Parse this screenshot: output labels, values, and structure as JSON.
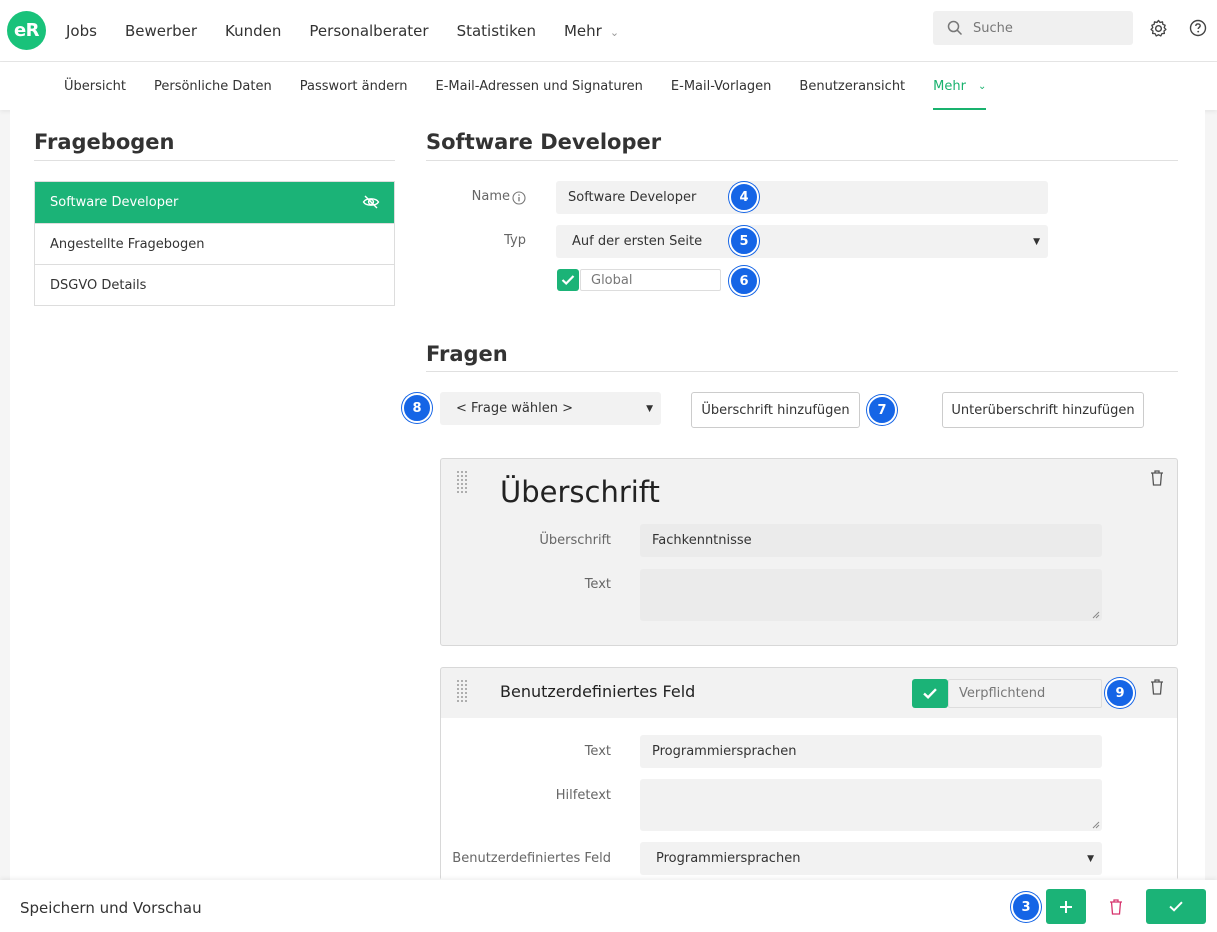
{
  "app": {
    "logo_text": "eR"
  },
  "main_nav": [
    {
      "label": "Jobs"
    },
    {
      "label": "Bewerber"
    },
    {
      "label": "Kunden"
    },
    {
      "label": "Personalberater"
    },
    {
      "label": "Statistiken"
    },
    {
      "label": "Mehr"
    }
  ],
  "search": {
    "placeholder": "Suche"
  },
  "sub_nav": [
    {
      "label": "Übersicht"
    },
    {
      "label": "Persönliche Daten"
    },
    {
      "label": "Passwort ändern"
    },
    {
      "label": "E-Mail-Adressen und Signaturen"
    },
    {
      "label": "E-Mail-Vorlagen"
    },
    {
      "label": "Benutzeransicht"
    },
    {
      "label": "Mehr"
    }
  ],
  "left": {
    "title": "Fragebogen",
    "items": [
      {
        "label": "Software Developer"
      },
      {
        "label": "Angestellte Fragebogen"
      },
      {
        "label": "DSGVO Details"
      }
    ]
  },
  "form": {
    "title": "Software Developer",
    "name_label": "Name",
    "name_value": "Software Developer",
    "typ_label": "Typ",
    "typ_value": "Auf der ersten Seite",
    "global_label": "Global",
    "global_checked": true
  },
  "fragen": {
    "title": "Fragen",
    "select_placeholder": "< Frage wählen >",
    "add_heading_button": "Überschrift hinzufügen",
    "add_subheading_button": "Unterüberschrift hinzufügen"
  },
  "card_heading": {
    "title": "Überschrift",
    "heading_label": "Überschrift",
    "heading_value": "Fachkenntnisse",
    "text_label": "Text",
    "text_value": ""
  },
  "card_custom": {
    "title": "Benutzerdefiniertes Feld",
    "required_label": "Verpflichtend",
    "required_checked": true,
    "text_label": "Text",
    "text_value": "Programmiersprachen",
    "helptext_label": "Hilfetext",
    "helptext_value": "",
    "custom_field_label": "Benutzerdefiniertes Feld",
    "custom_field_value": "Programmiersprachen"
  },
  "badges": {
    "b3": "3",
    "b4": "4",
    "b5": "5",
    "b6": "6",
    "b7": "7",
    "b8": "8",
    "b9": "9"
  },
  "bottom": {
    "title": "Speichern und Vorschau"
  },
  "colors": {
    "accent": "#1bb377",
    "badge": "#1565e6",
    "danger": "#d6336c"
  }
}
